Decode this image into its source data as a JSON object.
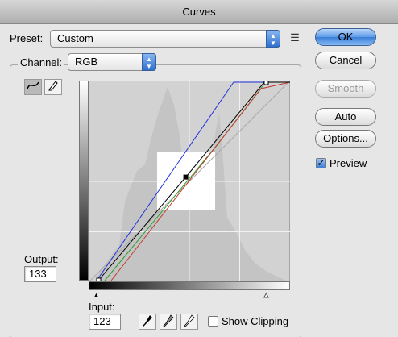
{
  "window": {
    "title": "Curves"
  },
  "preset": {
    "label": "Preset:",
    "value": "Custom"
  },
  "channel": {
    "label": "Channel:",
    "value": "RGB"
  },
  "buttons": {
    "ok": "OK",
    "cancel": "Cancel",
    "smooth": "Smooth",
    "auto": "Auto",
    "options": "Options..."
  },
  "preview": {
    "label": "Preview",
    "checked": true
  },
  "output": {
    "label": "Output:",
    "value": "133"
  },
  "input": {
    "label": "Input:",
    "value": "123"
  },
  "show_clipping": {
    "label": "Show Clipping",
    "checked": false
  },
  "icons": {
    "curve_tool": "curve-tool-icon",
    "pencil_tool": "pencil-icon",
    "preset_options": "list-icon",
    "black_point": "black-eyedropper-icon",
    "gray_point": "gray-eyedropper-icon",
    "white_point": "white-eyedropper-icon"
  },
  "curve": {
    "selected_point": {
      "input": 123,
      "output": 133
    },
    "range": [
      0,
      255
    ],
    "colors": {
      "composite": "#000000",
      "red": "#c0392b",
      "green": "#2f9e2f",
      "blue": "#2233dd",
      "histogram": "#c4c4c4",
      "grid_bg": "#d2d2d2"
    }
  }
}
